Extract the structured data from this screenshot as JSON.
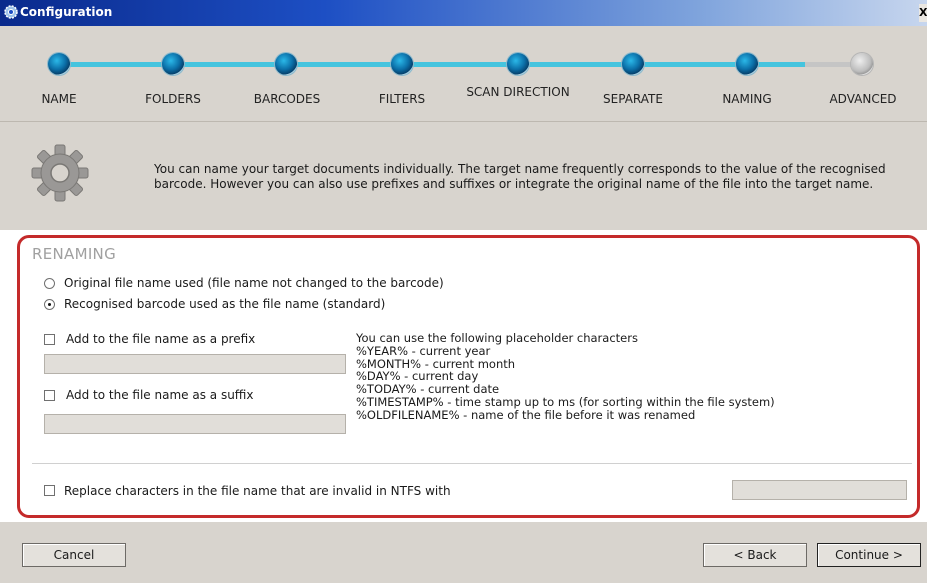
{
  "window": {
    "title": "Configuration",
    "close_label": "X"
  },
  "steps": [
    {
      "label": "NAME",
      "state": "done"
    },
    {
      "label": "FOLDERS",
      "state": "done"
    },
    {
      "label": "BARCODES",
      "state": "done"
    },
    {
      "label": "FILTERS",
      "state": "done"
    },
    {
      "label": "SCAN DIRECTION",
      "state": "done"
    },
    {
      "label": "SEPARATE",
      "state": "done"
    },
    {
      "label": "NAMING",
      "state": "current"
    },
    {
      "label": "ADVANCED",
      "state": "inactive"
    }
  ],
  "info": {
    "icon": "gear-icon",
    "text": "You can name your target documents individually. The target name frequently corresponds to the value of the recognised barcode. However you can also use prefixes and suffixes or integrate the original name of the file into the target name."
  },
  "renaming": {
    "title": "RENAMING",
    "radio_original": "Original file name used (file name not changed to the barcode)",
    "radio_barcode": "Recognised barcode used as the file name (standard)",
    "selected": "barcode",
    "prefix_label": "Add to the file name as a prefix",
    "prefix_value": "",
    "suffix_label": "Add to the file name as a suffix",
    "suffix_value": "",
    "placeholders_intro": "You can use the following placeholder characters",
    "placeholders": [
      "%YEAR% - current year",
      "%MONTH% - current month",
      "%DAY% - current day",
      "%TODAY% - current date",
      "%TIMESTAMP% - time stamp up to ms (for sorting within the file system)",
      "%OLDFILENAME% - name of the file before it was renamed"
    ],
    "replace_label": "Replace characters in the file name that are invalid in NTFS with",
    "replace_value": ""
  },
  "buttons": {
    "cancel": "Cancel",
    "back": "< Back",
    "continue": "Continue >"
  },
  "colors": {
    "accent": "#45c4de",
    "frame": "#c42a2a",
    "titlebar": "#1d4fc4"
  }
}
